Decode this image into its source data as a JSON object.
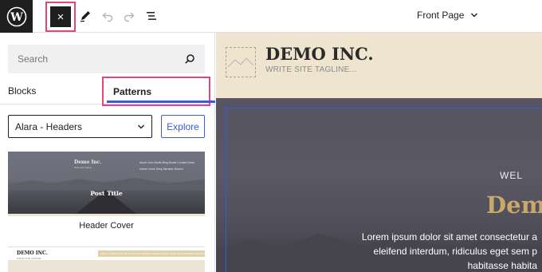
{
  "toolbar": {
    "close_label": "×",
    "page_title": "Front Page",
    "icons": [
      "wordpress-icon",
      "close-icon",
      "pen-icon",
      "undo-icon",
      "redo-icon",
      "list-view-icon",
      "chevron-down-icon"
    ],
    "highlight_color": "#e0457b"
  },
  "sidebar": {
    "search": {
      "placeholder": "Search"
    },
    "tabs": [
      {
        "label": "Blocks",
        "active": false
      },
      {
        "label": "Patterns",
        "active": true
      }
    ],
    "category_select": {
      "value": "Alara - Headers"
    },
    "explore_label": "Explore",
    "patterns": [
      {
        "label": "Header Cover",
        "preview": {
          "brand": "Demo Inc.",
          "brand_sub": "Write site tagline",
          "nav": "About John Smith   Blog   Books   Contact   News   Home   Home   Shop   Member Search",
          "title": "Post Title"
        }
      },
      {
        "label": "",
        "preview": {
          "brand": "DEMO INC.",
          "brand_sub": "WRITE SITE TAGLINE",
          "nav": "ABOUT JOHN SMITH  BLOG  BOOKS  CONTACT  HOME  HOME  HOME  SHOP  MEMBER SEARCH"
        }
      }
    ]
  },
  "canvas": {
    "site_title": "DEMO INC.",
    "site_tagline": "WRITE SITE TAGLINE...",
    "hero": {
      "eyebrow": "WEL",
      "title": "Dem",
      "text_lines": [
        "Lorem ipsum dolor sit amet consectetur a",
        "eleifend interdum, ridiculus eget sem p",
        "habitasse habita"
      ]
    },
    "colors": {
      "header_bg": "#efe5cf",
      "accent": "#c9a86b",
      "selection": "#3858e9"
    }
  }
}
